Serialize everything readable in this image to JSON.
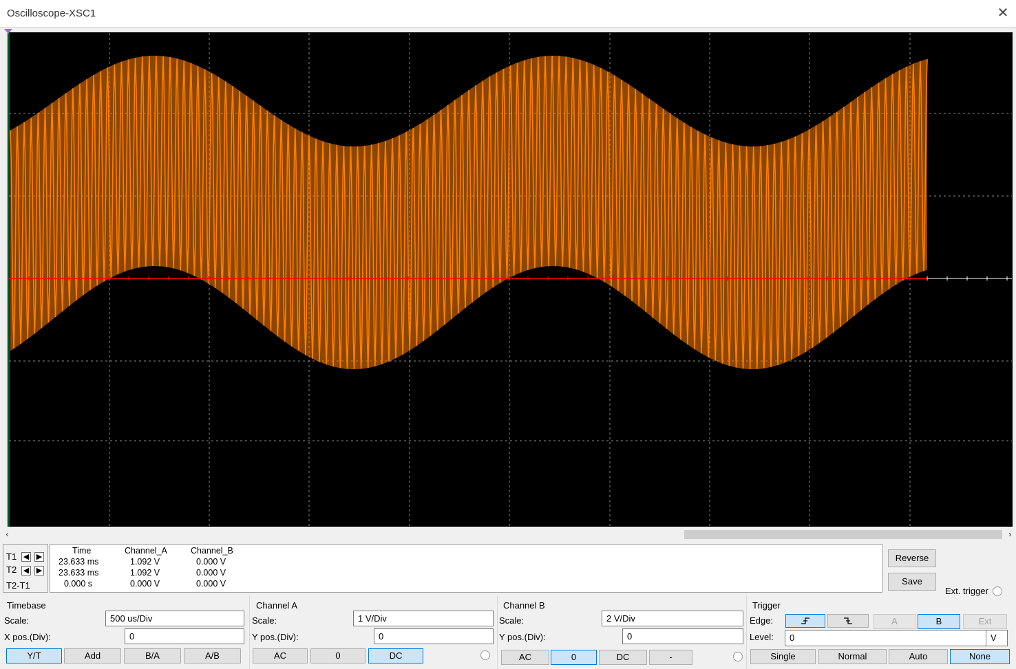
{
  "window": {
    "title": "Oscilloscope-XSC1",
    "close_icon": "close-icon"
  },
  "trace": {
    "color": "#ff8000",
    "baseline_color": "#ff0000",
    "carrier_cycles": 132,
    "envelope_cycles": 2.3,
    "upper_envelope": [
      1.6,
      2.7
    ],
    "lower_envelope": [
      -1.1,
      0.15
    ]
  },
  "cursors": {
    "t1_label": "T1",
    "t2_label": "T2",
    "diff_label": "T2-T1"
  },
  "readout": {
    "headers": [
      "Time",
      "Channel_A",
      "Channel_B"
    ],
    "rows": [
      [
        "23.633 ms",
        "1.092 V",
        "0.000 V"
      ],
      [
        "23.633 ms",
        "1.092 V",
        "0.000 V"
      ],
      [
        "0.000 s",
        "0.000 V",
        "0.000 V"
      ]
    ]
  },
  "buttons": {
    "reverse": "Reverse",
    "save": "Save",
    "ext_trigger": "Ext. trigger"
  },
  "timebase": {
    "title": "Timebase",
    "scale_label": "Scale:",
    "scale_value": "500 us/Div",
    "xpos_label": "X pos.(Div):",
    "xpos_value": "0",
    "modes": [
      "Y/T",
      "Add",
      "B/A",
      "A/B"
    ],
    "selected_mode": "Y/T"
  },
  "channel_a": {
    "title": "Channel A",
    "scale_label": "Scale:",
    "scale_value": "1  V/Div",
    "ypos_label": "Y pos.(Div):",
    "ypos_value": "0",
    "coupling": [
      "AC",
      "0",
      "DC"
    ],
    "selected": "DC"
  },
  "channel_b": {
    "title": "Channel B",
    "scale_label": "Scale:",
    "scale_value": "2  V/Div",
    "ypos_label": "Y pos.(Div):",
    "ypos_value": "0",
    "coupling": [
      "AC",
      "0",
      "DC",
      "-"
    ],
    "selected": "0"
  },
  "trigger": {
    "title": "Trigger",
    "edge_label": "Edge:",
    "sources": [
      "A",
      "B",
      "Ext"
    ],
    "selected_source": "B",
    "level_label": "Level:",
    "level_value": "0",
    "level_unit": "V",
    "modes": [
      "Single",
      "Normal",
      "Auto",
      "None"
    ],
    "selected_mode": "None"
  }
}
